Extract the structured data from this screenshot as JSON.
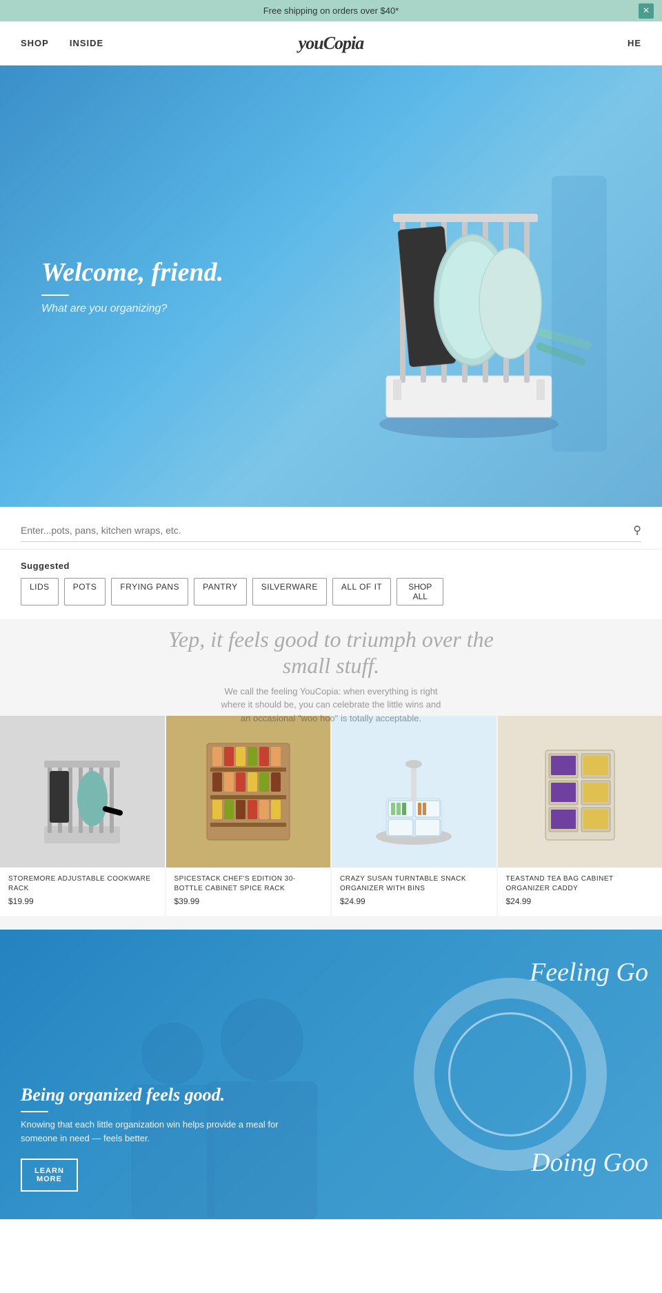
{
  "announcement": {
    "text": "Free shipping on orders over $40*",
    "close_icon": "×"
  },
  "nav": {
    "shop_label": "SHOP",
    "inside_label": "INSIDE",
    "logo_text": "youCopia",
    "right_label": "HE"
  },
  "hero": {
    "title": "Welcome, friend.",
    "subtitle": "What are you organizing?"
  },
  "search": {
    "placeholder": "Enter...pots, pans, kitchen wraps, etc.",
    "search_icon": "🔍"
  },
  "suggested": {
    "label": "Suggested",
    "tags": [
      {
        "label": "LIDS"
      },
      {
        "label": "POTS"
      },
      {
        "label": "FRYING PANS"
      },
      {
        "label": "PANTRY"
      },
      {
        "label": "SILVERWARE"
      },
      {
        "label": "ALL OF IT"
      }
    ],
    "shop_all_label": "SHOP\nALL"
  },
  "products_overlay": {
    "heading": "Yep, it feels good to triumph over the\nsmall stuff.",
    "body": "We call the feeling YouCopia: when everything is right where it should be, you can celebrate the little wins and an occasional \"woo hoo\" is totally acceptable."
  },
  "products": [
    {
      "name": "STOREMORE ADJUSTABLE COOKWARE RACK",
      "price": "$19.99",
      "color": "#d0d0d0"
    },
    {
      "name": "SPICESTACK CHEF'S EDITION 30-BOTTLE CABINET SPICE RACK",
      "price": "$39.99",
      "color": "#c8b89a"
    },
    {
      "name": "CRAZY SUSAN TURNTABLE SNACK ORGANIZER WITH BINS",
      "price": "$24.99",
      "color": "#e0f0f8"
    },
    {
      "name": "TEASTAND TEA BAG CABINET ORGANIZER CADDY",
      "price": "$24.99",
      "color": "#e8e0d0"
    }
  ],
  "cta": {
    "text_right1": "Feeling Go",
    "text_right2": "Doing Goo",
    "title": "Being organized feels good.",
    "body": "Knowing that each little organization win helps provide a meal for someone in need — feels better.",
    "button_label": "LEARN\nMORE"
  }
}
